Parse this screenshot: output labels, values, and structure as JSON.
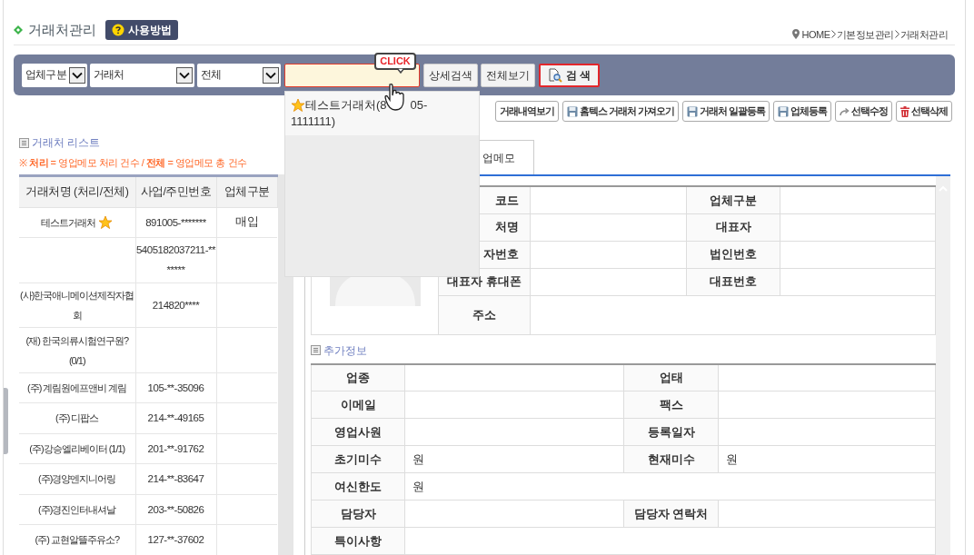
{
  "page_title": "거래처관리",
  "help_button": "사용방법",
  "breadcrumb": [
    "HOME",
    "기본정보관리",
    "거래처관리"
  ],
  "search_bar": {
    "selects": [
      {
        "value": "업체구분"
      },
      {
        "value": "거래처"
      },
      {
        "value": "전체"
      }
    ],
    "buttons": [
      {
        "label": "상세검색",
        "kind": "plain"
      },
      {
        "label": "전체보기",
        "kind": "plain"
      },
      {
        "label": "검 색",
        "kind": "primary"
      }
    ]
  },
  "callout": "CLICK",
  "autocomplete": {
    "items": [
      {
        "parts": [
          "테스트거래처(8",
          "05-",
          "1111111)"
        ],
        "starred": true
      }
    ]
  },
  "toolbar": [
    {
      "label": "거래내역보기"
    },
    {
      "label": "홈텍스 거래처 가져오기"
    },
    {
      "label": "거래처 일괄등록"
    },
    {
      "label": "업체등록"
    },
    {
      "label": "선택수정"
    },
    {
      "label": "선택삭제"
    }
  ],
  "list": {
    "title": "거래처 리스트",
    "note": "※ **처리** = 영업메모 처리 건수 / **전체** = 영업메모 총 건수",
    "columns": [
      "거래처명 (처리/전체)",
      "사업/주민번호",
      "업체구분"
    ],
    "rows": [
      {
        "name": "테스트거래처",
        "starred": true,
        "number": "891005-*******",
        "type": "매입"
      },
      {
        "starred": false,
        "number": "5405182037211-*******"
      },
      {
        "name": "(사)한국애니메이션제작자협회",
        "starred": false,
        "number": "214820****"
      },
      {
        "name": "(재)  한국의류시험연구원? (0/1)",
        "starred": false
      },
      {
        "name": "(주) 계림원에프앤비 계림",
        "starred": false,
        "number": "105-**-35096"
      },
      {
        "name": "(주) 디팝스",
        "starred": false,
        "number": "214-**-49165"
      },
      {
        "name": "(주)강승엘리베이터 (1/1)",
        "starred": false,
        "number": "201-**-91762"
      },
      {
        "name": "(주)경양엔지니어링",
        "starred": false,
        "number": "214-**-83647"
      },
      {
        "name": "(주)경진인터내셔날",
        "starred": false,
        "number": "203-**-50826"
      },
      {
        "name": "(주)  교현알뜰주유소?",
        "starred": false,
        "number": "127-**-37602"
      }
    ]
  },
  "tabs": [
    {
      "label": "업메모",
      "selected": true
    }
  ],
  "basic_info": [
    [
      {
        "label": "코드",
        "partly_hidden": true
      },
      {
        "label": "업체구분"
      }
    ],
    [
      {
        "label": "처명",
        "partly_hidden": true
      },
      {
        "label": "대표자"
      }
    ],
    [
      {
        "label": "자번호",
        "partly_hidden": true
      },
      {
        "label": "법인번호"
      }
    ],
    [
      {
        "label": "대표자 휴대폰"
      },
      {
        "label": "대표번호"
      }
    ],
    [
      {
        "label": "주소"
      }
    ]
  ],
  "extra_info": {
    "title": "추가정보",
    "rows": [
      [
        {
          "label": "업종"
        },
        {
          "label": "업태"
        }
      ],
      [
        {
          "label": "이메일"
        },
        {
          "label": "팩스"
        }
      ],
      [
        {
          "label": "영업사원"
        },
        {
          "label": "등록일자"
        }
      ],
      [
        {
          "label": "초기미수",
          "value": "원"
        },
        {
          "label": "현재미수",
          "value": "원"
        }
      ],
      [
        {
          "label": "여신한도",
          "value": "원"
        }
      ],
      [
        {
          "label": "담당자"
        },
        {
          "label": "담당자 연락처"
        }
      ],
      [
        {
          "label": "특이사항"
        }
      ]
    ]
  }
}
